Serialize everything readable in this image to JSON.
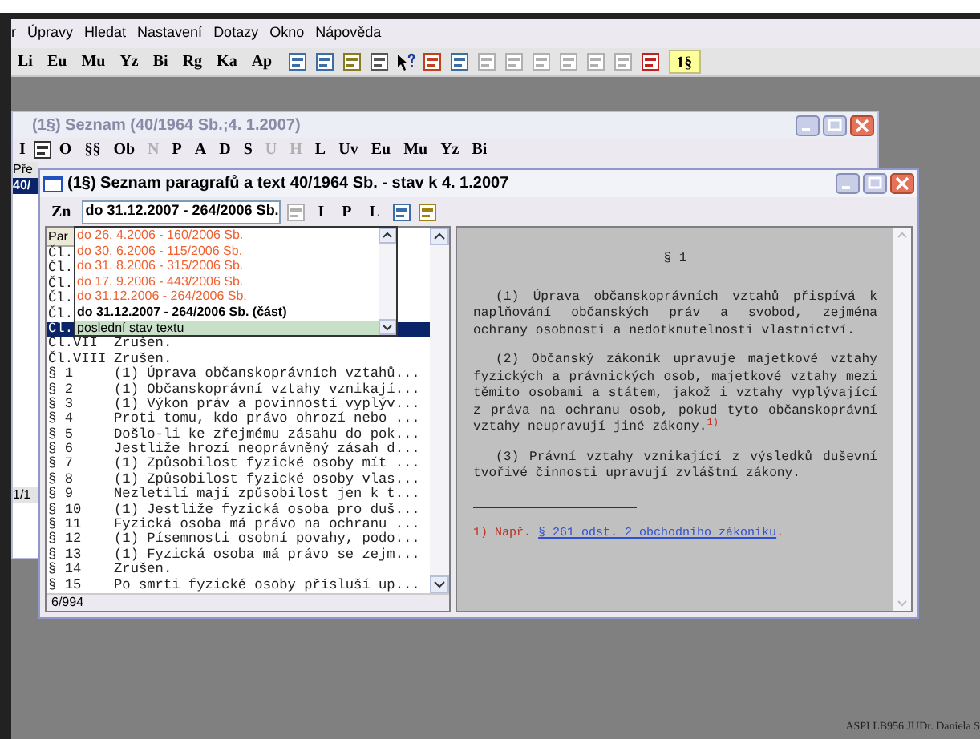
{
  "menu": [
    "r",
    "Úpravy",
    "Hledat",
    "Nastavení",
    "Dotazy",
    "Okno",
    "Nápověda"
  ],
  "main_toolbar": [
    {
      "kind": "text",
      "label": "Li"
    },
    {
      "kind": "text",
      "label": "Eu"
    },
    {
      "kind": "text",
      "label": "Mu"
    },
    {
      "kind": "text",
      "label": "Yz"
    },
    {
      "kind": "text",
      "label": "Bi"
    },
    {
      "kind": "text",
      "label": "Rg"
    },
    {
      "kind": "text",
      "label": "Ka"
    },
    {
      "kind": "text",
      "label": "Ap"
    },
    {
      "kind": "icons"
    },
    {
      "kind": "active",
      "label": "1§"
    }
  ],
  "list_window": {
    "title": "(1§)  Seznam (40/1964 Sb.;4. 1.2007)",
    "toolbar": [
      {
        "label": "I",
        "disabled": false
      },
      {
        "label": "O",
        "disabled": false
      },
      {
        "label": "§§",
        "disabled": false
      },
      {
        "label": "Ob",
        "disabled": false
      },
      {
        "label": "N",
        "disabled": true
      },
      {
        "label": "P",
        "disabled": false
      },
      {
        "label": "A",
        "disabled": false
      },
      {
        "label": "D",
        "disabled": false
      },
      {
        "label": "S",
        "disabled": false
      },
      {
        "label": "U",
        "disabled": true
      },
      {
        "label": "H",
        "disabled": true
      },
      {
        "label": "L",
        "disabled": false
      },
      {
        "label": "Uv",
        "disabled": false
      },
      {
        "label": "Eu",
        "disabled": false
      },
      {
        "label": "Mu",
        "disabled": false
      },
      {
        "label": "Yz",
        "disabled": false
      },
      {
        "label": "Bi",
        "disabled": false
      }
    ],
    "column_header": "Pře",
    "rows": [
      {
        "text": "40/",
        "selected": true
      }
    ],
    "pager": "1/1"
  },
  "text_window": {
    "title": "(1§)  Seznam paragrafů a text 40/1964 Sb. - stav k  4. 1.2007",
    "version_button": "Zn",
    "version_select": "do 31.12.2007 -  264/2006 Sb.",
    "toolbar": [
      "I",
      "P",
      "L"
    ],
    "versions": [
      {
        "label": "do 26. 4.2006 -  160/2006 Sb.",
        "kind": "past",
        "selected": false
      },
      {
        "label": "do 30. 6.2006 -  115/2006 Sb.",
        "kind": "past",
        "selected": false
      },
      {
        "label": "do 31. 8.2006 -  315/2006 Sb.",
        "kind": "past",
        "selected": false
      },
      {
        "label": "do 17. 9.2006 -  443/2006 Sb.",
        "kind": "past",
        "selected": false
      },
      {
        "label": "do 31.12.2006 -  264/2006 Sb.",
        "kind": "past",
        "selected": false
      },
      {
        "label": "do 31.12.2007 -  264/2006 Sb. (část)",
        "kind": "current",
        "selected": false
      },
      {
        "label": "poslední stav textu",
        "kind": "latest",
        "selected": true
      }
    ],
    "list_header": "Par",
    "rows": [
      {
        "para": "Čl.",
        "text": "",
        "selected": false
      },
      {
        "para": "Čl.",
        "text": "",
        "selected": false
      },
      {
        "para": "Čl.",
        "text": "",
        "selected": false
      },
      {
        "para": "Čl.",
        "text": "",
        "selected": false
      },
      {
        "para": "Čl.",
        "text": "",
        "selected": false
      },
      {
        "para": "Čl.",
        "text": "",
        "selected": true
      },
      {
        "para": "Čl.VII",
        "text": "Zrušen.",
        "selected": false
      },
      {
        "para": "Čl.VIII",
        "text": "Zrušen.",
        "selected": false
      },
      {
        "para": "§ 1",
        "text": "(1) Úprava občanskoprávních vztahů...",
        "selected": false
      },
      {
        "para": "§ 2",
        "text": "(1) Občanskoprávní vztahy vznikají...",
        "selected": false
      },
      {
        "para": "§ 3",
        "text": "(1) Výkon práv a povinností vyplýv...",
        "selected": false
      },
      {
        "para": "§ 4",
        "text": "Proti tomu, kdo právo ohrozí nebo ...",
        "selected": false
      },
      {
        "para": "§ 5",
        "text": "Došlo-li ke zřejmému zásahu do pok...",
        "selected": false
      },
      {
        "para": "§ 6",
        "text": "Jestliže hrozí neoprávněný zásah d...",
        "selected": false
      },
      {
        "para": "§ 7",
        "text": "(1) Způsobilost fyzické osoby mít ...",
        "selected": false
      },
      {
        "para": "§ 8",
        "text": "(1) Způsobilost fyzické osoby vlas...",
        "selected": false
      },
      {
        "para": "§ 9",
        "text": "Nezletilí mají způsobilost jen k t...",
        "selected": false
      },
      {
        "para": "§ 10",
        "text": "(1) Jestliže fyzická osoba pro duš...",
        "selected": false
      },
      {
        "para": "§ 11",
        "text": "Fyzická osoba má právo na ochranu ...",
        "selected": false
      },
      {
        "para": "§ 12",
        "text": "(1) Písemnosti osobní povahy, podo...",
        "selected": false
      },
      {
        "para": "§ 13",
        "text": "(1) Fyzická osoba má právo se zejm...",
        "selected": false
      },
      {
        "para": "§ 14",
        "text": "Zrušen.",
        "selected": false
      },
      {
        "para": "§ 15",
        "text": "Po smrti fyzické osoby přísluší up...",
        "selected": false
      }
    ],
    "row_count": "6/994",
    "heading": "§ 1",
    "paragraphs": [
      "(1) Úprava občanskoprávních vztahů přispívá k naplňování občanských práv a svobod, zejména ochrany osobnosti a nedotknutelnosti vlastnictví.",
      "(2) Občanský zákoník upravuje majetkové vztahy fyzických a právnických osob, majetkové vztahy mezi těmito osobami a státem, jakož i vztahy vyplývající z práva na ochranu osob, pokud tyto občanskoprávní vztahy neupravují jiné zákony.$^{1)}$",
      "(3) Právní vztahy vznikající z výsledků duševní tvořivé činnosti upravují zvláštní zákony."
    ],
    "footnote": {
      "mark": "1) Např.",
      "link": "§ 261 odst. 2 obchodního zákoníku",
      "end": "."
    }
  },
  "status_bar": "ASPI LB956 JUDr. Daniela S"
}
